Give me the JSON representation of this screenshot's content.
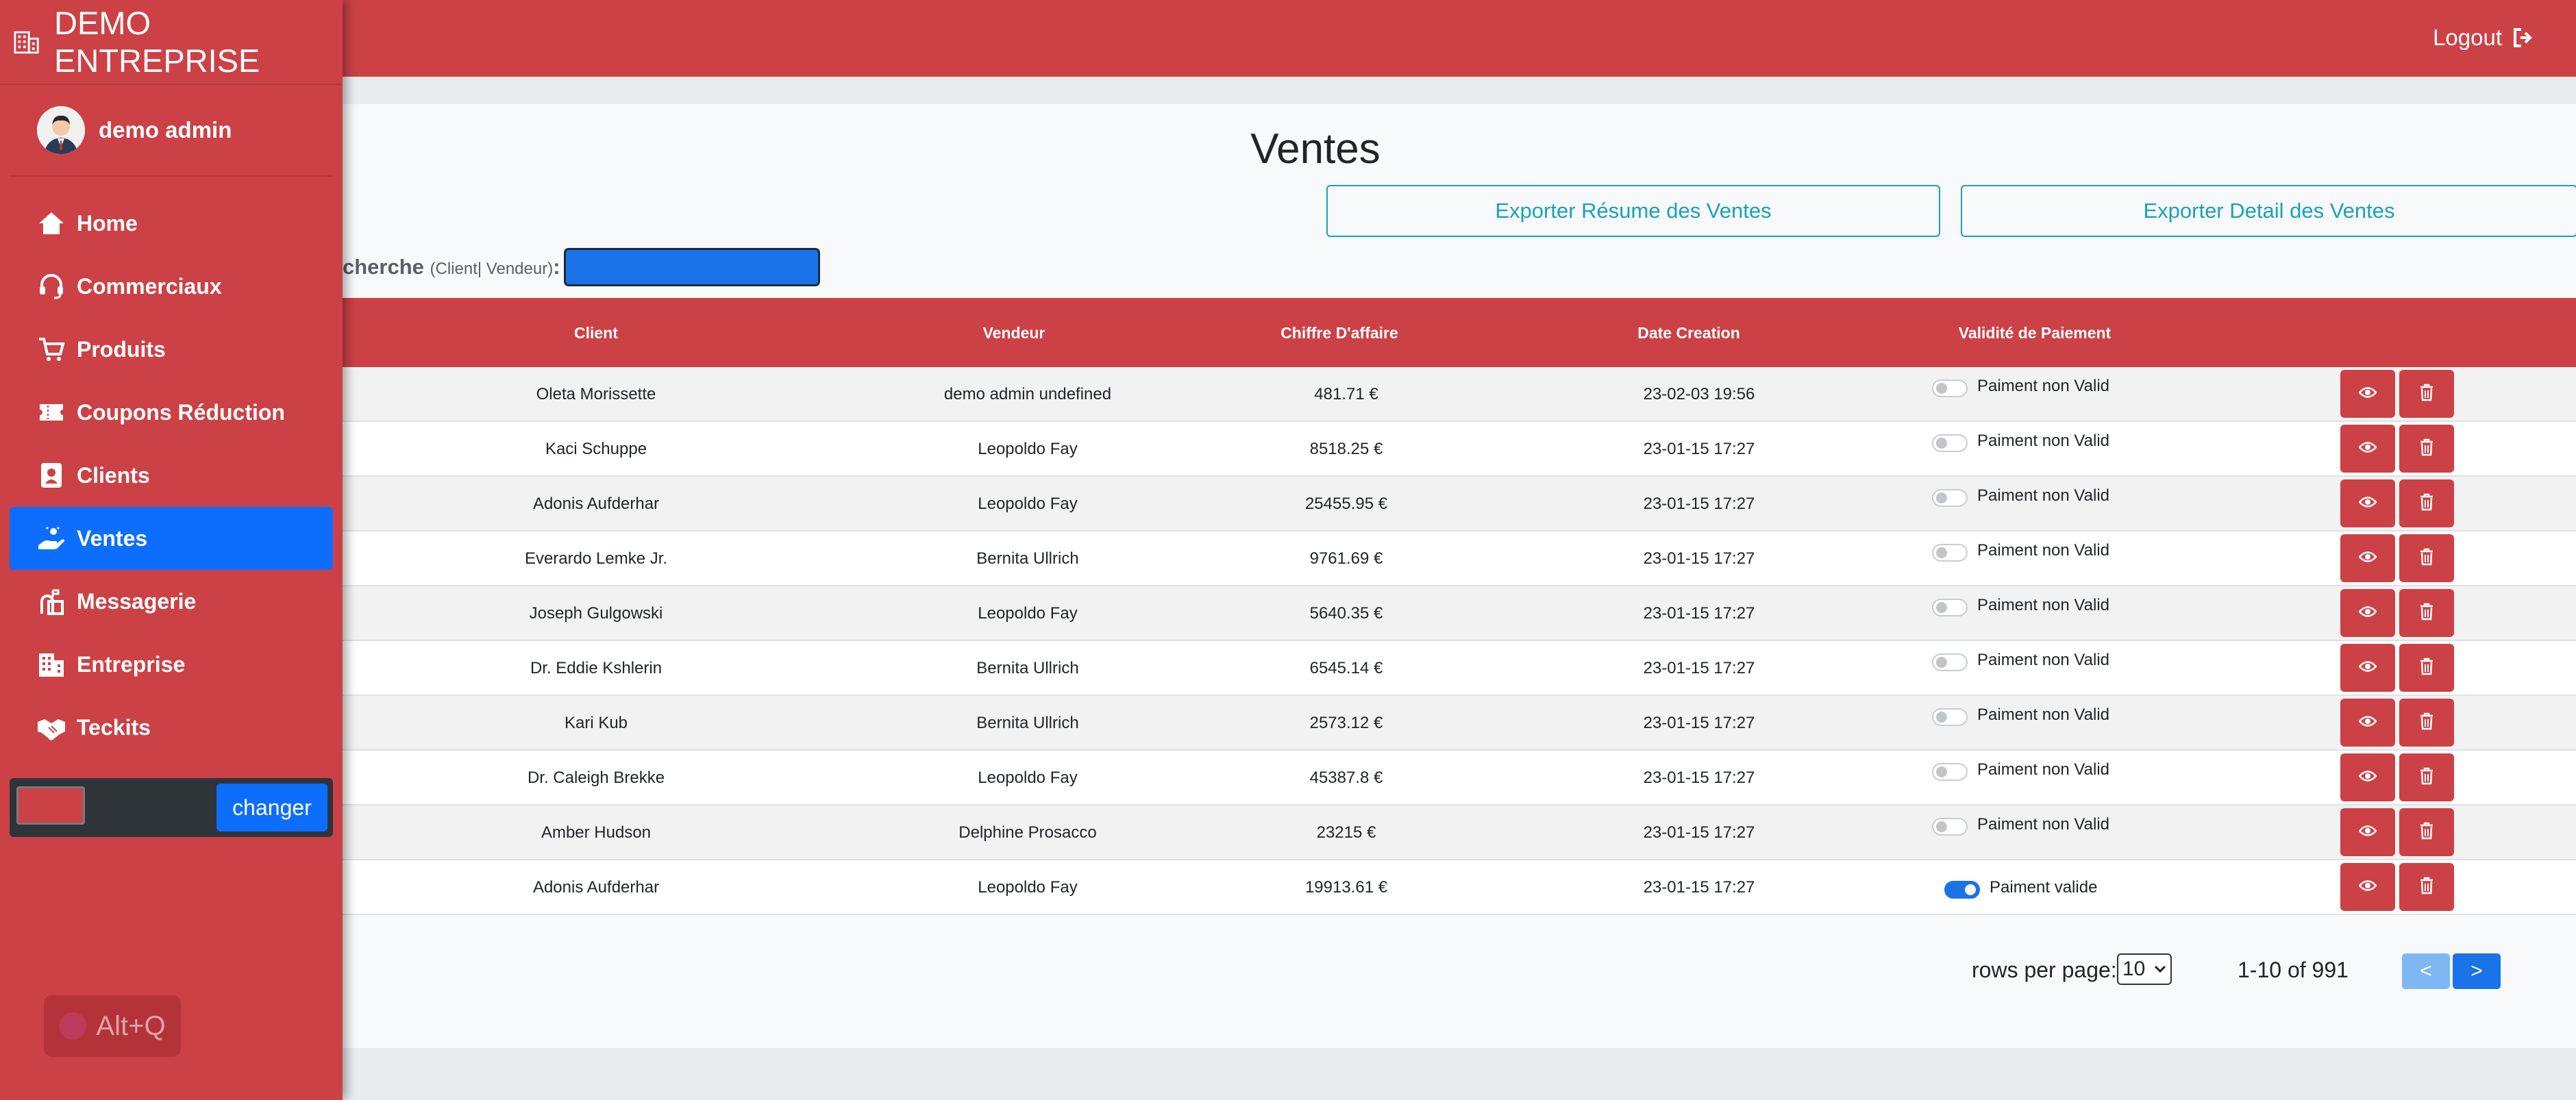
{
  "app": {
    "brand": "DEMO ENTREPRISE",
    "user_name": "demo admin",
    "logout_label": "Logout"
  },
  "colors": {
    "primary": "#cc4146",
    "active": "#0d6efd",
    "info": "#17a2b8"
  },
  "sidebar": {
    "items": [
      {
        "label": "Home",
        "icon": "home-icon",
        "active": false
      },
      {
        "label": "Commerciaux",
        "icon": "headset-icon",
        "active": false
      },
      {
        "label": "Produits",
        "icon": "cart-icon",
        "active": false
      },
      {
        "label": "Coupons Réduction",
        "icon": "ticket-icon",
        "active": false
      },
      {
        "label": "Clients",
        "icon": "contact-card-icon",
        "active": false
      },
      {
        "label": "Ventes",
        "icon": "hand-holding-icon",
        "active": true
      },
      {
        "label": "Messagerie",
        "icon": "mailbox-icon",
        "active": false
      },
      {
        "label": "Entreprise",
        "icon": "building-icon",
        "active": false
      },
      {
        "label": "Teckits",
        "icon": "handshake-icon",
        "active": false
      }
    ],
    "changer_label": "changer",
    "theme_color": "#cc4146"
  },
  "main": {
    "title": "Ventes",
    "export_summary_label": "Exporter Résume des Ventes",
    "export_detail_label": "Exporter Detail des Ventes",
    "search_label": "cherche",
    "search_hint": "(Client| Vendeur)",
    "search_colon": ":",
    "search_value": ""
  },
  "table": {
    "headers": {
      "client": "Client",
      "vendeur": "Vendeur",
      "ca": "Chiffre D'affaire",
      "date": "Date Creation",
      "validite": "Validité de Paiement"
    },
    "rows": [
      {
        "client": "Oleta Morissette",
        "vendeur": "demo admin undefined",
        "ca": "481.71 €",
        "date": "23-02-03 19:56",
        "valid": false,
        "valid_label": "Paiment non Valid"
      },
      {
        "client": "Kaci Schuppe",
        "vendeur": "Leopoldo Fay",
        "ca": "8518.25 €",
        "date": "23-01-15 17:27",
        "valid": false,
        "valid_label": "Paiment non Valid"
      },
      {
        "client": "Adonis Aufderhar",
        "vendeur": "Leopoldo Fay",
        "ca": "25455.95 €",
        "date": "23-01-15 17:27",
        "valid": false,
        "valid_label": "Paiment non Valid"
      },
      {
        "client": "Everardo Lemke Jr.",
        "vendeur": "Bernita Ullrich",
        "ca": "9761.69 €",
        "date": "23-01-15 17:27",
        "valid": false,
        "valid_label": "Paiment non Valid"
      },
      {
        "client": "Joseph Gulgowski",
        "vendeur": "Leopoldo Fay",
        "ca": "5640.35 €",
        "date": "23-01-15 17:27",
        "valid": false,
        "valid_label": "Paiment non Valid"
      },
      {
        "client": "Dr. Eddie Kshlerin",
        "vendeur": "Bernita Ullrich",
        "ca": "6545.14 €",
        "date": "23-01-15 17:27",
        "valid": false,
        "valid_label": "Paiment non Valid"
      },
      {
        "client": "Kari Kub",
        "vendeur": "Bernita Ullrich",
        "ca": "2573.12 €",
        "date": "23-01-15 17:27",
        "valid": false,
        "valid_label": "Paiment non Valid"
      },
      {
        "client": "Dr. Caleigh Brekke",
        "vendeur": "Leopoldo Fay",
        "ca": "45387.8 €",
        "date": "23-01-15 17:27",
        "valid": false,
        "valid_label": "Paiment non Valid"
      },
      {
        "client": "Amber Hudson",
        "vendeur": "Delphine Prosacco",
        "ca": "23215 €",
        "date": "23-01-15 17:27",
        "valid": false,
        "valid_label": "Paiment non Valid"
      },
      {
        "client": "Adonis Aufderhar",
        "vendeur": "Leopoldo Fay",
        "ca": "19913.61 €",
        "date": "23-01-15 17:27",
        "valid": true,
        "valid_label": "Paiment valide"
      }
    ]
  },
  "pagination": {
    "rows_per_page_label": "rows per page:",
    "rows_per_page": "10",
    "range": "1-10 of 991",
    "prev": "<",
    "next": ">"
  },
  "overlay": {
    "shortcut_label": "Alt+Q"
  }
}
